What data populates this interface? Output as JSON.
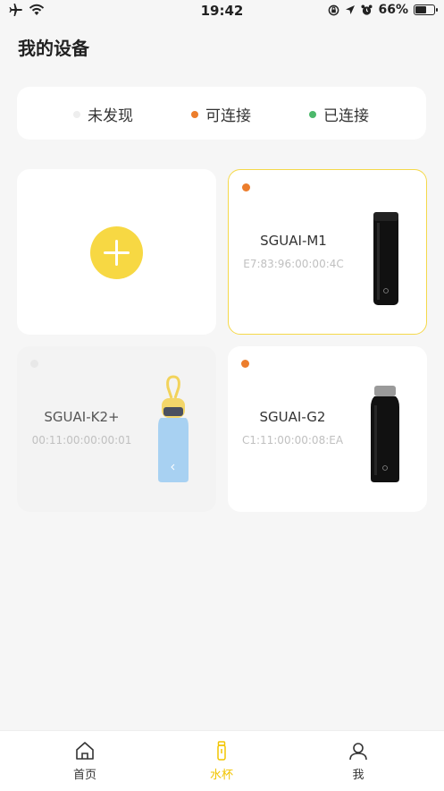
{
  "status_bar": {
    "time": "19:42",
    "battery_percent": "66%",
    "battery_level": 0.66
  },
  "page": {
    "title": "我的设备"
  },
  "legend": [
    {
      "label": "未发现",
      "color": "#eeeeee"
    },
    {
      "label": "可连接",
      "color": "#ec7d2c"
    },
    {
      "label": "已连接",
      "color": "#4cb86b"
    }
  ],
  "devices": [
    {
      "name": "SGUAI-M1",
      "mac": "E7:83:96:00:00:4C",
      "status_color": "#ec7d2c"
    },
    {
      "name": "SGUAI-K2+",
      "mac": "00:11:00:00:00:01",
      "status_color": "#e8e8e8"
    },
    {
      "name": "SGUAI-G2",
      "mac": "C1:11:00:00:08:EA",
      "status_color": "#ec7d2c"
    }
  ],
  "tabs": [
    {
      "label": "首页",
      "icon": "home-icon"
    },
    {
      "label": "水杯",
      "icon": "bottle-icon",
      "active": true
    },
    {
      "label": "我",
      "icon": "user-icon"
    }
  ],
  "colors": {
    "accent": "#f2c500",
    "add_button": "#f7d843"
  }
}
